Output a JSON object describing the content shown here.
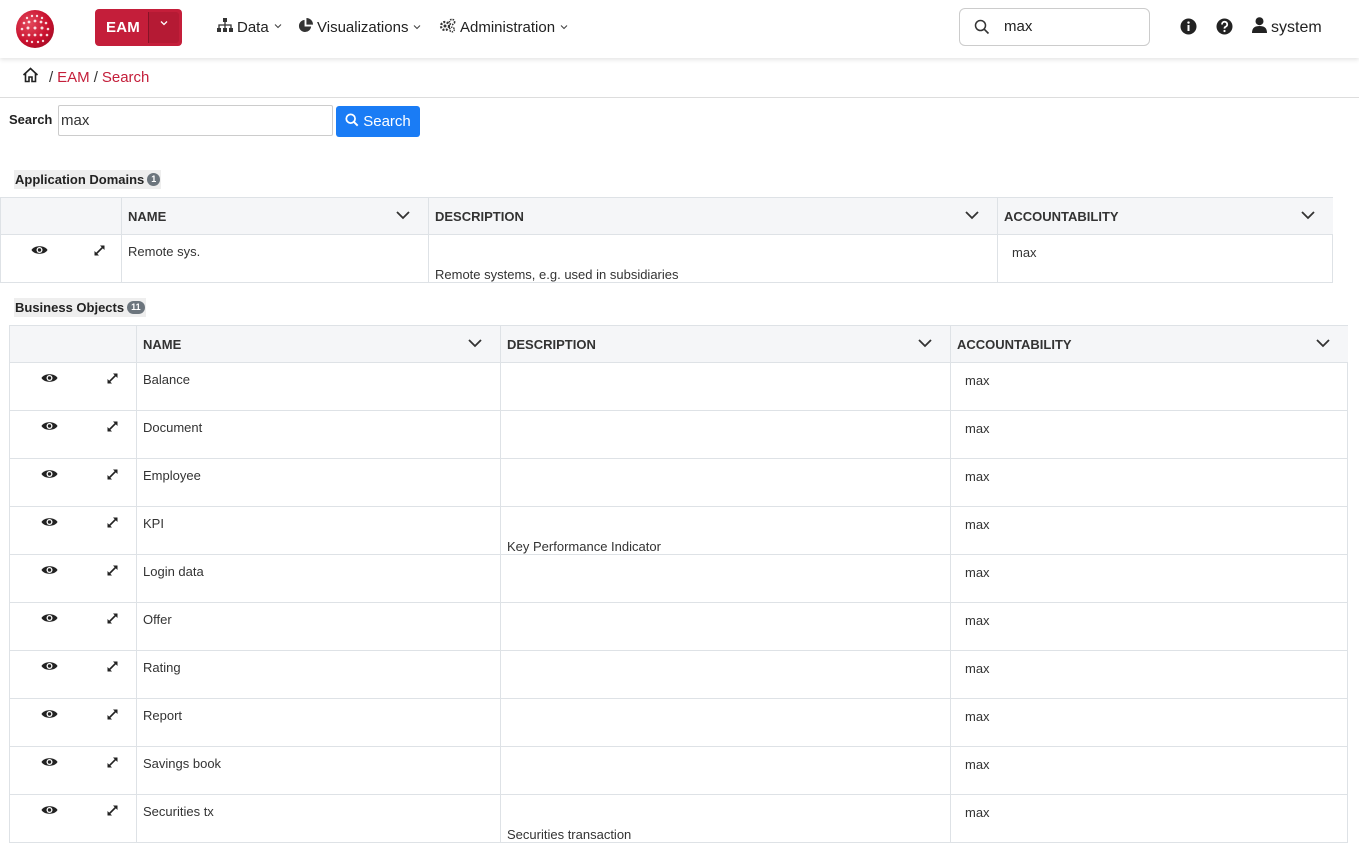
{
  "header": {
    "app_button_label": "EAM",
    "menus": [
      {
        "label": "Data",
        "icon": "sitemap-icon"
      },
      {
        "label": "Visualizations",
        "icon": "pie-chart-icon"
      },
      {
        "label": "Administration",
        "icon": "gears-icon"
      }
    ],
    "search_value": "max",
    "user_name": "system",
    "brand_color": "#c41e3a"
  },
  "breadcrumb": {
    "items": [
      "EAM",
      "Search"
    ]
  },
  "search_form": {
    "label": "Search",
    "value": "max",
    "button_label": "Search",
    "button_color": "#1a7cf5"
  },
  "app_domains": {
    "title": "Application Domains",
    "count": "1",
    "columns": [
      "NAME",
      "DESCRIPTION",
      "ACCOUNTABILITY"
    ],
    "rows": [
      {
        "name": "Remote sys.",
        "description": "Remote systems, e.g. used in subsidiaries",
        "accountability": "max"
      }
    ]
  },
  "business_objects": {
    "title": "Business Objects",
    "count": "11",
    "columns": [
      "NAME",
      "DESCRIPTION",
      "ACCOUNTABILITY"
    ],
    "rows": [
      {
        "name": "Balance",
        "description": "",
        "accountability": "max"
      },
      {
        "name": "Document",
        "description": "",
        "accountability": "max"
      },
      {
        "name": "Employee",
        "description": "",
        "accountability": "max"
      },
      {
        "name": "KPI",
        "description": "Key Performance Indicator",
        "accountability": "max"
      },
      {
        "name": "Login data",
        "description": "",
        "accountability": "max"
      },
      {
        "name": "Offer",
        "description": "",
        "accountability": "max"
      },
      {
        "name": "Rating",
        "description": "",
        "accountability": "max"
      },
      {
        "name": "Report",
        "description": "",
        "accountability": "max"
      },
      {
        "name": "Savings book",
        "description": "",
        "accountability": "max"
      },
      {
        "name": "Securities tx",
        "description": "Securities transaction",
        "accountability": "max"
      }
    ]
  }
}
